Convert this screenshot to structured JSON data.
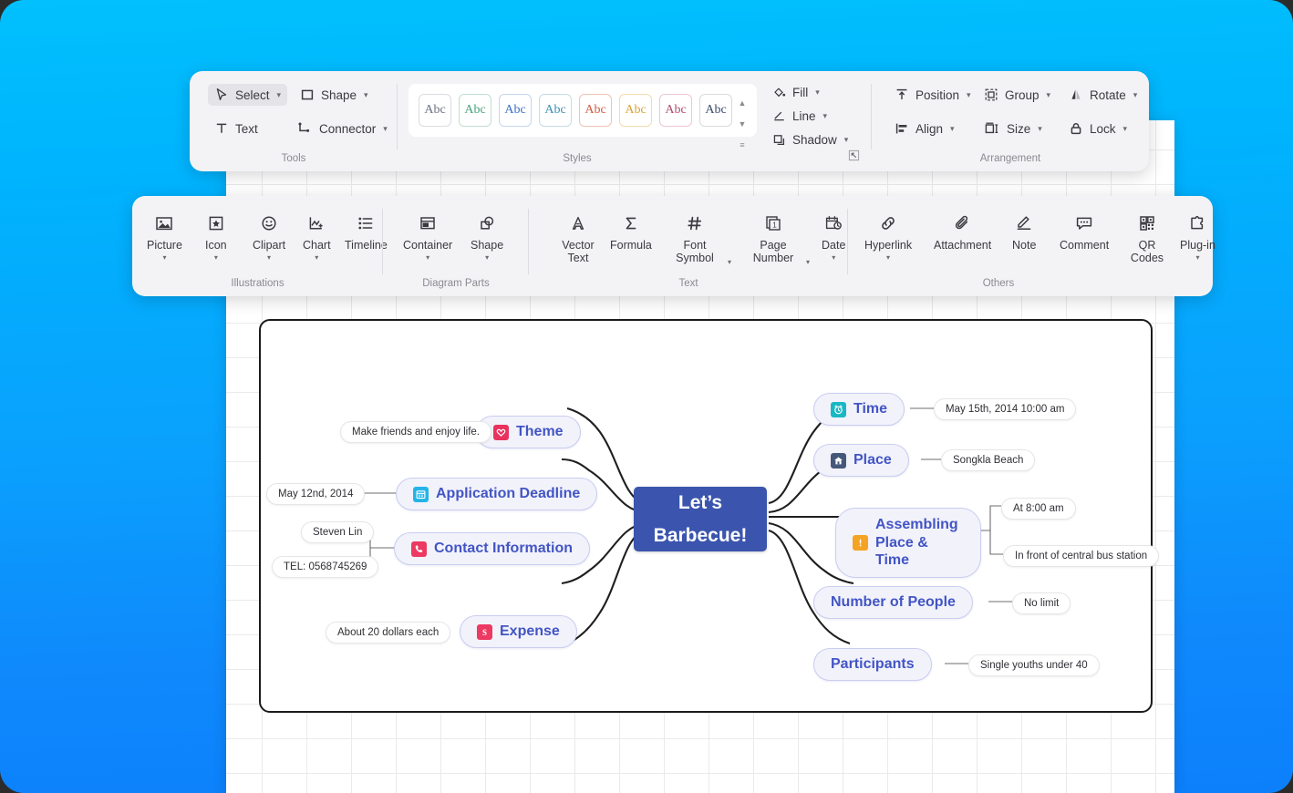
{
  "theme": {
    "bg_top": "#01c0fd",
    "bg_bottom": "#0c80fb",
    "ribbon_bg": "#f3f3f5",
    "central_fill": "#3b55ae",
    "branch_fill": "#f2f2fb",
    "branch_text": "#4255c4"
  },
  "ribbon_top": {
    "groups": [
      {
        "title": "Tools",
        "items": [
          {
            "label": "Select",
            "icon": "cursor-arrow-icon",
            "has_caret": true,
            "selected": true
          },
          {
            "label": "Shape",
            "icon": "square-icon",
            "has_caret": true,
            "selected": false
          },
          {
            "label": "Text",
            "icon": "text-t-icon",
            "has_caret": false,
            "selected": false
          },
          {
            "label": "Connector",
            "icon": "connector-icon",
            "has_caret": true,
            "selected": false
          }
        ]
      },
      {
        "title": "Styles",
        "swatch_label": "Abc",
        "swatches": [
          {
            "text": "#6b7280",
            "border": "#dcdce2"
          },
          {
            "text": "#46a37a",
            "border": "#bfe0d0"
          },
          {
            "text": "#3b6fc4",
            "border": "#c6d6ef"
          },
          {
            "text": "#3b8fb0",
            "border": "#c4dde6"
          },
          {
            "text": "#d2593f",
            "border": "#f0c3b6"
          },
          {
            "text": "#d9a233",
            "border": "#f2dcaf"
          },
          {
            "text": "#b04a6e",
            "border": "#eec6d4"
          },
          {
            "text": "#3a4a6b",
            "border": "#d8dade"
          }
        ],
        "scroll_up": "▲",
        "scroll_down": "▼",
        "scroll_more": "≡",
        "side_items": [
          {
            "label": "Fill",
            "icon": "fill-bucket-icon",
            "has_caret": true
          },
          {
            "label": "Line",
            "icon": "line-pen-icon",
            "has_caret": true
          },
          {
            "label": "Shadow",
            "icon": "shadow-icon",
            "has_caret": true
          }
        ]
      },
      {
        "title": "Arrangement",
        "items": [
          {
            "label": "Position",
            "icon": "position-icon",
            "has_caret": true
          },
          {
            "label": "Group",
            "icon": "group-icon",
            "has_caret": true
          },
          {
            "label": "Rotate",
            "icon": "rotate-icon",
            "has_caret": true
          },
          {
            "label": "Align",
            "icon": "align-icon",
            "has_caret": true
          },
          {
            "label": "Size",
            "icon": "size-icon",
            "has_caret": true
          },
          {
            "label": "Lock",
            "icon": "lock-icon",
            "has_caret": true
          }
        ]
      }
    ]
  },
  "ribbon_bottom": {
    "groups": [
      {
        "title": "Illustrations",
        "items": [
          {
            "label": "Picture",
            "icon": "picture-icon",
            "dropdown": true
          },
          {
            "label": "Icon",
            "icon": "star-box-icon",
            "dropdown": true
          },
          {
            "label": "Clipart",
            "icon": "smiley-icon",
            "dropdown": true
          },
          {
            "label": "Chart",
            "icon": "chart-plus-icon",
            "dropdown": true
          },
          {
            "label": "Timeline",
            "icon": "timeline-list-icon",
            "dropdown": false
          }
        ]
      },
      {
        "title": "Diagram Parts",
        "items": [
          {
            "label": "Container",
            "icon": "container-icon",
            "dropdown": true
          },
          {
            "label": "Shape",
            "icon": "shapes-overlap-icon",
            "dropdown": true
          }
        ]
      },
      {
        "title": "Text",
        "items": [
          {
            "label": "Vector Text",
            "icon": "vector-a-icon",
            "dropdown": false,
            "caret": false
          },
          {
            "label": "Formula",
            "icon": "sigma-icon",
            "dropdown": false,
            "caret": false
          },
          {
            "label": "Font Symbol",
            "icon": "hash-icon",
            "dropdown": false,
            "caret": true
          },
          {
            "label": "Page Number",
            "icon": "page-number-icon",
            "dropdown": false,
            "caret": true
          },
          {
            "label": "Date",
            "icon": "calendar-clock-icon",
            "dropdown": true,
            "caret": false
          }
        ]
      },
      {
        "title": "Others",
        "items": [
          {
            "label": "Hyperlink",
            "icon": "link-icon",
            "dropdown": true
          },
          {
            "label": "Attachment",
            "icon": "paperclip-icon",
            "dropdown": false
          },
          {
            "label": "Note",
            "icon": "note-pencil-icon",
            "dropdown": false
          },
          {
            "label": "Comment",
            "icon": "comment-bubble-icon",
            "dropdown": false
          },
          {
            "label": "QR Codes",
            "icon": "qr-code-icon",
            "dropdown": false
          },
          {
            "label": "Plug-in",
            "icon": "puzzle-icon",
            "dropdown": true
          }
        ]
      }
    ]
  },
  "mindmap": {
    "central": {
      "line1": "Let’s",
      "line2": "Barbecue!"
    },
    "branches_right": [
      {
        "label": "Time",
        "icon": "clock-icon",
        "icon_color": "#18b8c4",
        "leaves": [
          "May 15th, 2014    10:00 am"
        ]
      },
      {
        "label": "Place",
        "icon": "house-icon",
        "icon_color": "#46587a",
        "leaves": [
          "Songkla Beach"
        ]
      },
      {
        "label_line1": "Assembling",
        "label_line2": "Place & Time",
        "label": "Assembling Place & Time",
        "icon": "exclamation-icon",
        "icon_color": "#f4a325",
        "leaves": [
          "At 8:00 am",
          "In front of central bus station"
        ]
      },
      {
        "label": "Number of People",
        "icon": null,
        "leaves": [
          "No limit"
        ]
      },
      {
        "label": "Participants",
        "icon": null,
        "leaves": [
          "Single youths under 40"
        ]
      }
    ],
    "branches_left": [
      {
        "label": "Theme",
        "icon": "heart-icon",
        "icon_color": "#e8335e",
        "leaves": [
          "Make friends and enjoy life."
        ]
      },
      {
        "label": "Application Deadline",
        "icon": "calendar-icon",
        "icon_color": "#23b4e8",
        "leaves": [
          "May 12nd, 2014"
        ]
      },
      {
        "label": "Contact Information",
        "icon": "phone-icon",
        "icon_color": "#ec3a63",
        "leaves": [
          "Steven Lin",
          "TEL: 0568745269"
        ]
      },
      {
        "label": "Expense",
        "icon": "dollar-icon",
        "icon_color": "#ec3a63",
        "leaves": [
          "About 20 dollars each"
        ]
      }
    ]
  }
}
